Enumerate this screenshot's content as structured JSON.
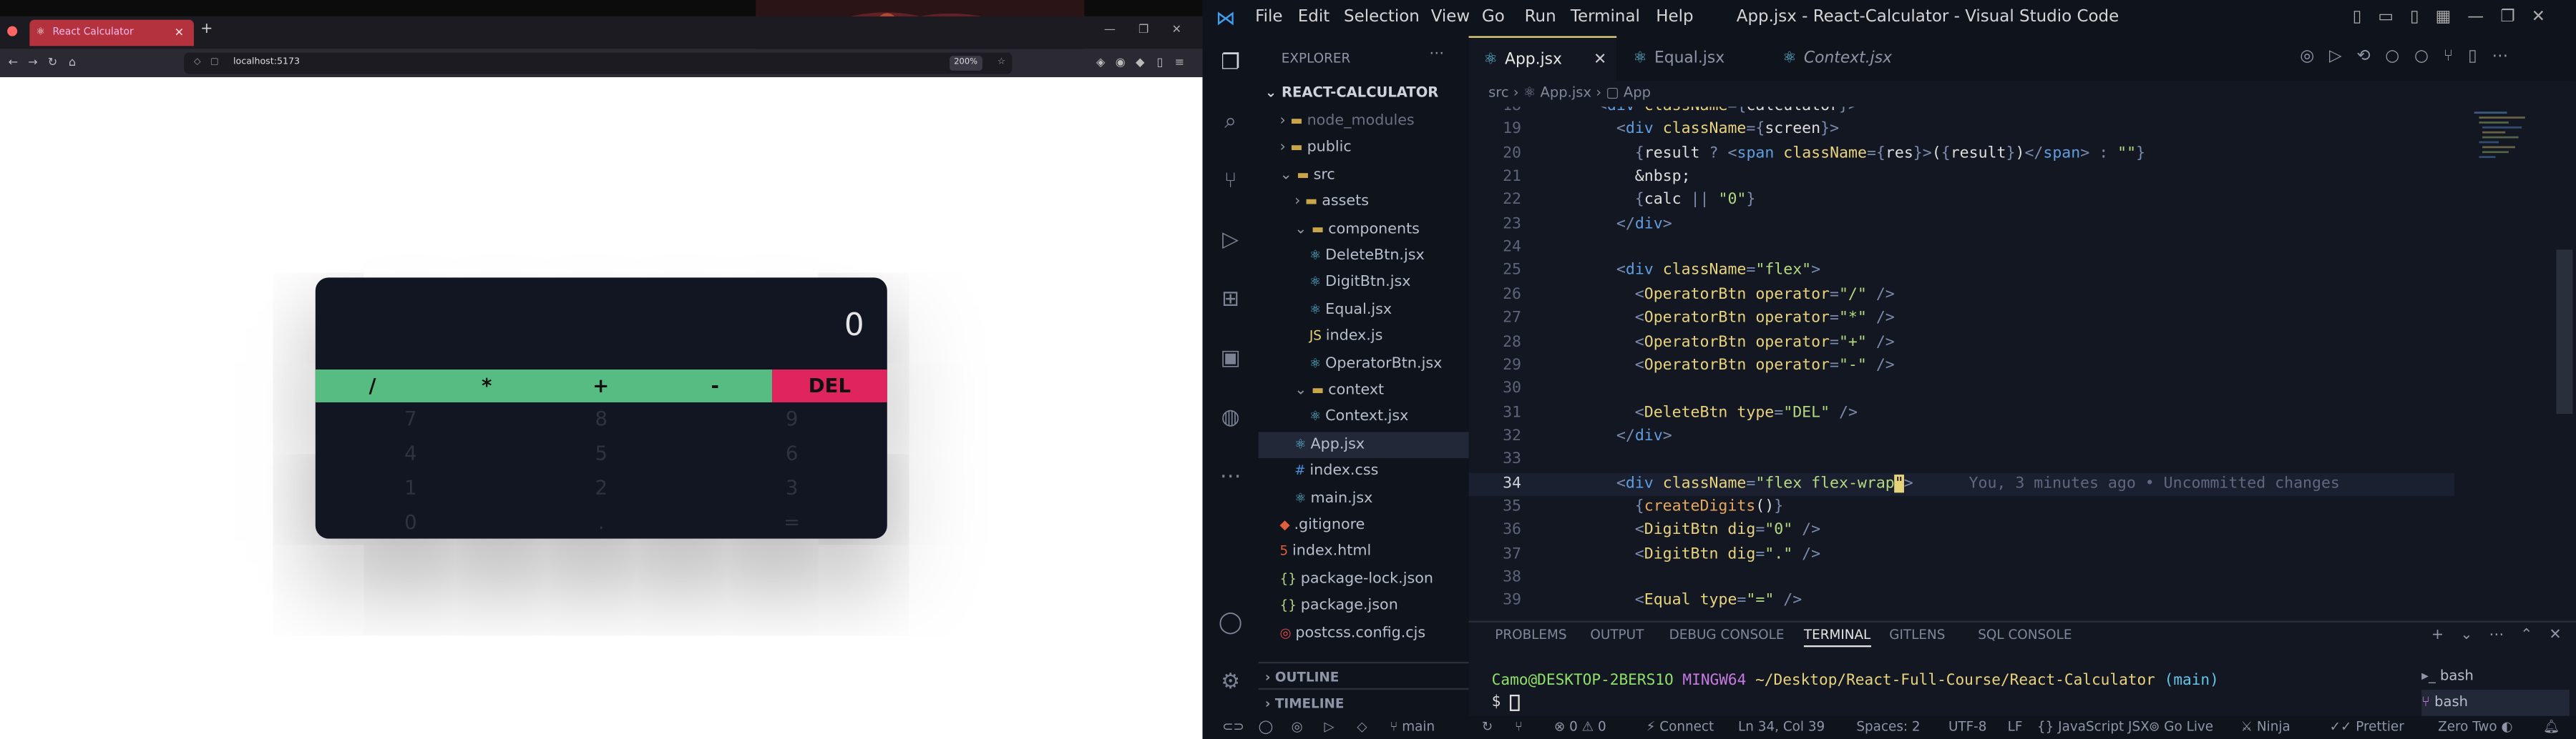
{
  "browser": {
    "tab_title": "React Calculator",
    "url": "localhost:5173",
    "zoom": "200%",
    "new_tab": "+"
  },
  "calculator": {
    "display": "0",
    "operators": [
      "/",
      "*",
      "+",
      "-"
    ],
    "delete_label": "DEL",
    "digits": [
      "7",
      "8",
      "9",
      "4",
      "5",
      "6",
      "1",
      "2",
      "3",
      "0",
      ".",
      "="
    ]
  },
  "vscode": {
    "title": "App.jsx - React-Calculator - Visual Studio Code",
    "menu": [
      "File",
      "Edit",
      "Selection",
      "View",
      "Go",
      "Run",
      "Terminal",
      "Help"
    ],
    "explorer_label": "EXPLORER",
    "project": "REACT-CALCULATOR",
    "tree": [
      {
        "name": "node_modules",
        "indent": 1,
        "kind": "folder",
        "chev": "›"
      },
      {
        "name": "public",
        "indent": 1,
        "kind": "folder",
        "chev": "›"
      },
      {
        "name": "src",
        "indent": 1,
        "kind": "folder",
        "chev": "⌄"
      },
      {
        "name": "assets",
        "indent": 2,
        "kind": "folder",
        "chev": "›"
      },
      {
        "name": "components",
        "indent": 2,
        "kind": "folder",
        "chev": "⌄"
      },
      {
        "name": "DeleteBtn.jsx",
        "indent": 3,
        "kind": "react"
      },
      {
        "name": "DigitBtn.jsx",
        "indent": 3,
        "kind": "react"
      },
      {
        "name": "Equal.jsx",
        "indent": 3,
        "kind": "react"
      },
      {
        "name": "index.js",
        "indent": 3,
        "kind": "js"
      },
      {
        "name": "OperatorBtn.jsx",
        "indent": 3,
        "kind": "react"
      },
      {
        "name": "context",
        "indent": 2,
        "kind": "folder",
        "chev": "⌄"
      },
      {
        "name": "Context.jsx",
        "indent": 3,
        "kind": "react"
      },
      {
        "name": "App.jsx",
        "indent": 2,
        "kind": "react",
        "active": true
      },
      {
        "name": "index.css",
        "indent": 2,
        "kind": "css"
      },
      {
        "name": "main.jsx",
        "indent": 2,
        "kind": "react"
      },
      {
        "name": ".gitignore",
        "indent": 1,
        "kind": "git"
      },
      {
        "name": "index.html",
        "indent": 1,
        "kind": "html"
      },
      {
        "name": "package-lock.json",
        "indent": 1,
        "kind": "json"
      },
      {
        "name": "package.json",
        "indent": 1,
        "kind": "json"
      },
      {
        "name": "postcss.config.cjs",
        "indent": 1,
        "kind": "postcss"
      }
    ],
    "outline": "OUTLINE",
    "timeline": "TIMELINE",
    "tabs": [
      "App.jsx",
      "Equal.jsx",
      "Context.jsx"
    ],
    "breadcrumb": [
      "src",
      "App.jsx",
      "App"
    ],
    "lines": [
      {
        "no": "19",
        "html": "<span class='p'>&lt;</span><span class='k'>div</span> <span class='a'>className</span><span class='p'>={</span><span class='t'>screen</span><span class='p'>}&gt;</span>",
        "ind": 3
      },
      {
        "no": "20",
        "html": "<span class='p'>{</span><span class='t'>result</span> <span class='p'>?</span> <span class='p'>&lt;</span><span class='k'>span</span> <span class='a'>className</span><span class='p'>={</span><span class='t'>res</span><span class='p'>}&gt;</span><span class='t'>(</span><span class='p'>{</span><span class='t'>result</span><span class='p'>}</span><span class='t'>)</span><span class='p'>&lt;/</span><span class='k'>span</span><span class='p'>&gt;</span> <span class='p'>:</span> <span class='s'>\"\"</span><span class='p'>}</span>",
        "ind": 4
      },
      {
        "no": "21",
        "html": "<span class='t'>&amp;nbsp;</span>",
        "ind": 4
      },
      {
        "no": "22",
        "html": "<span class='p'>{</span><span class='t'>calc</span> <span class='p'>||</span> <span class='s'>\"0\"</span><span class='p'>}</span>",
        "ind": 4
      },
      {
        "no": "23",
        "html": "<span class='p'>&lt;/</span><span class='k'>div</span><span class='p'>&gt;</span>",
        "ind": 3
      },
      {
        "no": "24",
        "html": "",
        "ind": 0
      },
      {
        "no": "25",
        "html": "<span class='p'>&lt;</span><span class='k'>div</span> <span class='a'>className</span><span class='p'>=</span><span class='s'>\"flex\"</span><span class='p'>&gt;</span>",
        "ind": 3
      },
      {
        "no": "26",
        "html": "<span class='p'>&lt;</span><span class='a'>OperatorBtn</span> <span class='a'>operator</span><span class='p'>=</span><span class='s'>\"/\"</span> <span class='p'>/&gt;</span>",
        "ind": 4
      },
      {
        "no": "27",
        "html": "<span class='p'>&lt;</span><span class='a'>OperatorBtn</span> <span class='a'>operator</span><span class='p'>=</span><span class='s'>\"*\"</span> <span class='p'>/&gt;</span>",
        "ind": 4
      },
      {
        "no": "28",
        "html": "<span class='p'>&lt;</span><span class='a'>OperatorBtn</span> <span class='a'>operator</span><span class='p'>=</span><span class='s'>\"+\"</span> <span class='p'>/&gt;</span>",
        "ind": 4
      },
      {
        "no": "29",
        "html": "<span class='p'>&lt;</span><span class='a'>OperatorBtn</span> <span class='a'>operator</span><span class='p'>=</span><span class='s'>\"-\"</span> <span class='p'>/&gt;</span>",
        "ind": 4
      },
      {
        "no": "30",
        "html": "",
        "ind": 0
      },
      {
        "no": "31",
        "html": "<span class='p'>&lt;</span><span class='a'>DeleteBtn</span> <span class='a'>type</span><span class='p'>=</span><span class='s'>\"DEL\"</span> <span class='p'>/&gt;</span>",
        "ind": 4
      },
      {
        "no": "32",
        "html": "<span class='p'>&lt;/</span><span class='k'>div</span><span class='p'>&gt;</span>",
        "ind": 3
      },
      {
        "no": "33",
        "html": "",
        "ind": 0
      },
      {
        "no": "34",
        "html": "<span class='p'>&lt;</span><span class='k'>div</span> <span class='a'>className</span><span class='p'>=</span><span class='s'>\"flex flex-wrap</span><span style='background:#e8d37d;color:#111'>\"</span><span class='p'>&gt;</span>      <span class='c'>You, 3 minutes ago • Uncommitted changes</span>",
        "ind": 3,
        "cur": true
      },
      {
        "no": "35",
        "html": "<span class='p'>{</span><span class='n'>createDigits</span><span class='t'>()</span><span class='p'>}</span>",
        "ind": 4
      },
      {
        "no": "36",
        "html": "<span class='p'>&lt;</span><span class='a'>DigitBtn</span> <span class='a'>dig</span><span class='p'>=</span><span class='s'>\"0\"</span> <span class='p'>/&gt;</span>",
        "ind": 4
      },
      {
        "no": "37",
        "html": "<span class='p'>&lt;</span><span class='a'>DigitBtn</span> <span class='a'>dig</span><span class='p'>=</span><span class='s'>\".\"</span> <span class='p'>/&gt;</span>",
        "ind": 4
      },
      {
        "no": "38",
        "html": "",
        "ind": 0
      },
      {
        "no": "39",
        "html": "<span class='p'>&lt;</span><span class='a'>Equal</span> <span class='a'>type</span><span class='p'>=</span><span class='s'>\"=\"</span> <span class='p'>/&gt;</span>",
        "ind": 4
      }
    ],
    "panel_tabs": [
      "PROBLEMS",
      "OUTPUT",
      "DEBUG CONSOLE",
      "TERMINAL",
      "GITLENS",
      "SQL CONSOLE"
    ],
    "terminal_user": "Camo@DESKTOP-2BERS1O",
    "terminal_shell": "MINGW64",
    "terminal_path": "~/Desktop/React-Full-Course/React-Calculator",
    "terminal_branch": "(main)",
    "terminal_prompt": "$",
    "shells": [
      "bash",
      "bash"
    ],
    "status": {
      "branch": "main",
      "problems": "⊗ 0 ⚠ 0",
      "connect": "Connect",
      "position": "Ln 34, Col 39",
      "spaces": "Spaces: 2",
      "encoding": "UTF-8",
      "eol": "LF",
      "lang": "JavaScript JSX",
      "golive": "Go Live",
      "ninja": "Ninja",
      "prettier": "Prettier",
      "theme": "Zero Two"
    }
  }
}
